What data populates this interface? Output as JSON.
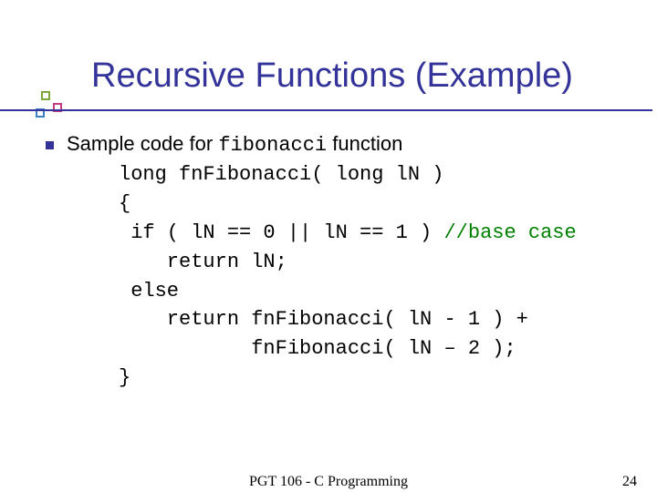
{
  "title": "Recursive Functions (Example)",
  "lead": {
    "prefix": "Sample code for ",
    "mono": "fibonacci",
    "suffix": " function"
  },
  "code": {
    "l1": "long fnFibonacci( long lN )",
    "l2": "{",
    "l3a": " if ( lN == 0 || lN == 1 ) ",
    "l3b": "//base case",
    "l4": "    return lN;",
    "l5": " else",
    "l6": "    return fnFibonacci( lN - 1 ) +",
    "l7": "           fnFibonacci( lN – 2 );",
    "l8": "}"
  },
  "footer": {
    "center": "PGT 106 - C Programming",
    "page": "24"
  }
}
